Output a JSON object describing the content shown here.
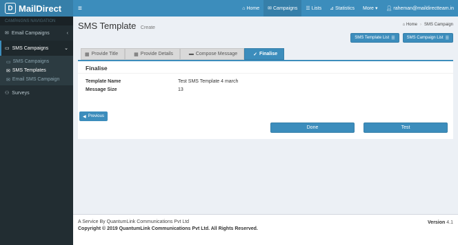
{
  "brand": {
    "name": "MailDirect",
    "logo_letter": "D"
  },
  "topnav": {
    "toggle_icon": "hamburger-icon",
    "items": [
      {
        "label": "Home",
        "icon": "home-icon"
      },
      {
        "label": "Campaigns",
        "icon": "envelope-icon"
      },
      {
        "label": "Lists",
        "icon": "list-icon"
      },
      {
        "label": "Statistics",
        "icon": "chart-icon"
      },
      {
        "label": "More",
        "icon": "caret-down-icon"
      },
      {
        "label": "raheman@maildirectteam.in",
        "icon": "user-icon"
      }
    ]
  },
  "sidebar": {
    "header": "CAMPAIGNS NAVIGATION",
    "email_campaigns": "Email Campaigns",
    "sms_campaigns": "SMS Campaigns",
    "sub": [
      "SMS Campaigns",
      "SMS Templates",
      "Email SMS Campaign"
    ],
    "surveys": "Surveys"
  },
  "page": {
    "title": "SMS Template",
    "subtitle": "Create",
    "breadcrumb": [
      "Home",
      "SMS Campaign"
    ],
    "btn_template_list": "SMS Template List",
    "btn_campaign_list": "SMS Campaign List"
  },
  "wizard": {
    "steps": [
      "Provide Title",
      "Provide Details",
      "Compose Message",
      "Finalise"
    ],
    "active_index": 3
  },
  "finalise": {
    "heading": "Finalise",
    "template_name_label": "Template Name",
    "template_name_value": "Test SMS Template 4 march",
    "message_size_label": "Message Size",
    "message_size_value": "13"
  },
  "actions": {
    "previous": "Previous",
    "done": "Done",
    "test": "Test"
  },
  "footer": {
    "service": "A Service By QuantumLink Communications Pvt Ltd",
    "copyright": "Copyright © 2019 QuantumLink Communications Pvt Ltd. All Rights Reserved.",
    "version_label": "Version",
    "version_value": "4.1"
  },
  "colors": {
    "accent": "#3c8dbc",
    "accent_dark": "#367fa9",
    "sidebar": "#222d32"
  }
}
